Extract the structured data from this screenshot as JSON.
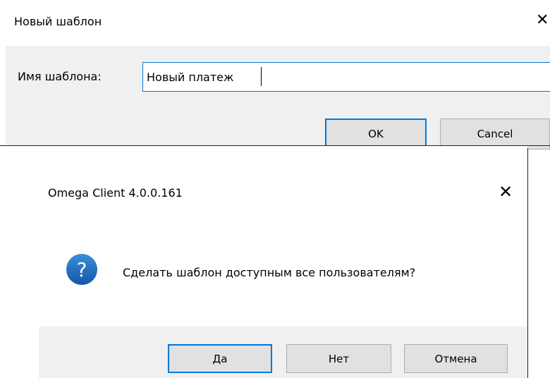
{
  "dialog1": {
    "title": "Новый шаблон",
    "close_glyph": "✕",
    "name_label": "Имя шаблона:",
    "name_value": "Новый платеж",
    "ok_label": "OK",
    "cancel_label": "Cancel"
  },
  "dialog2": {
    "title": "Omega Client 4.0.0.161",
    "close_glyph": "✕",
    "icon": "question-icon",
    "icon_glyph": "?",
    "message": "Сделать шаблон доступным все пользователям?",
    "yes_label": "Да",
    "no_label": "Нет",
    "cancel_label": "Отмена"
  },
  "colors": {
    "accent": "#0078d7",
    "dialog_footer": "#f0f0f0",
    "button_face": "#e1e1e1",
    "question_icon_fill": "#1e73be"
  }
}
